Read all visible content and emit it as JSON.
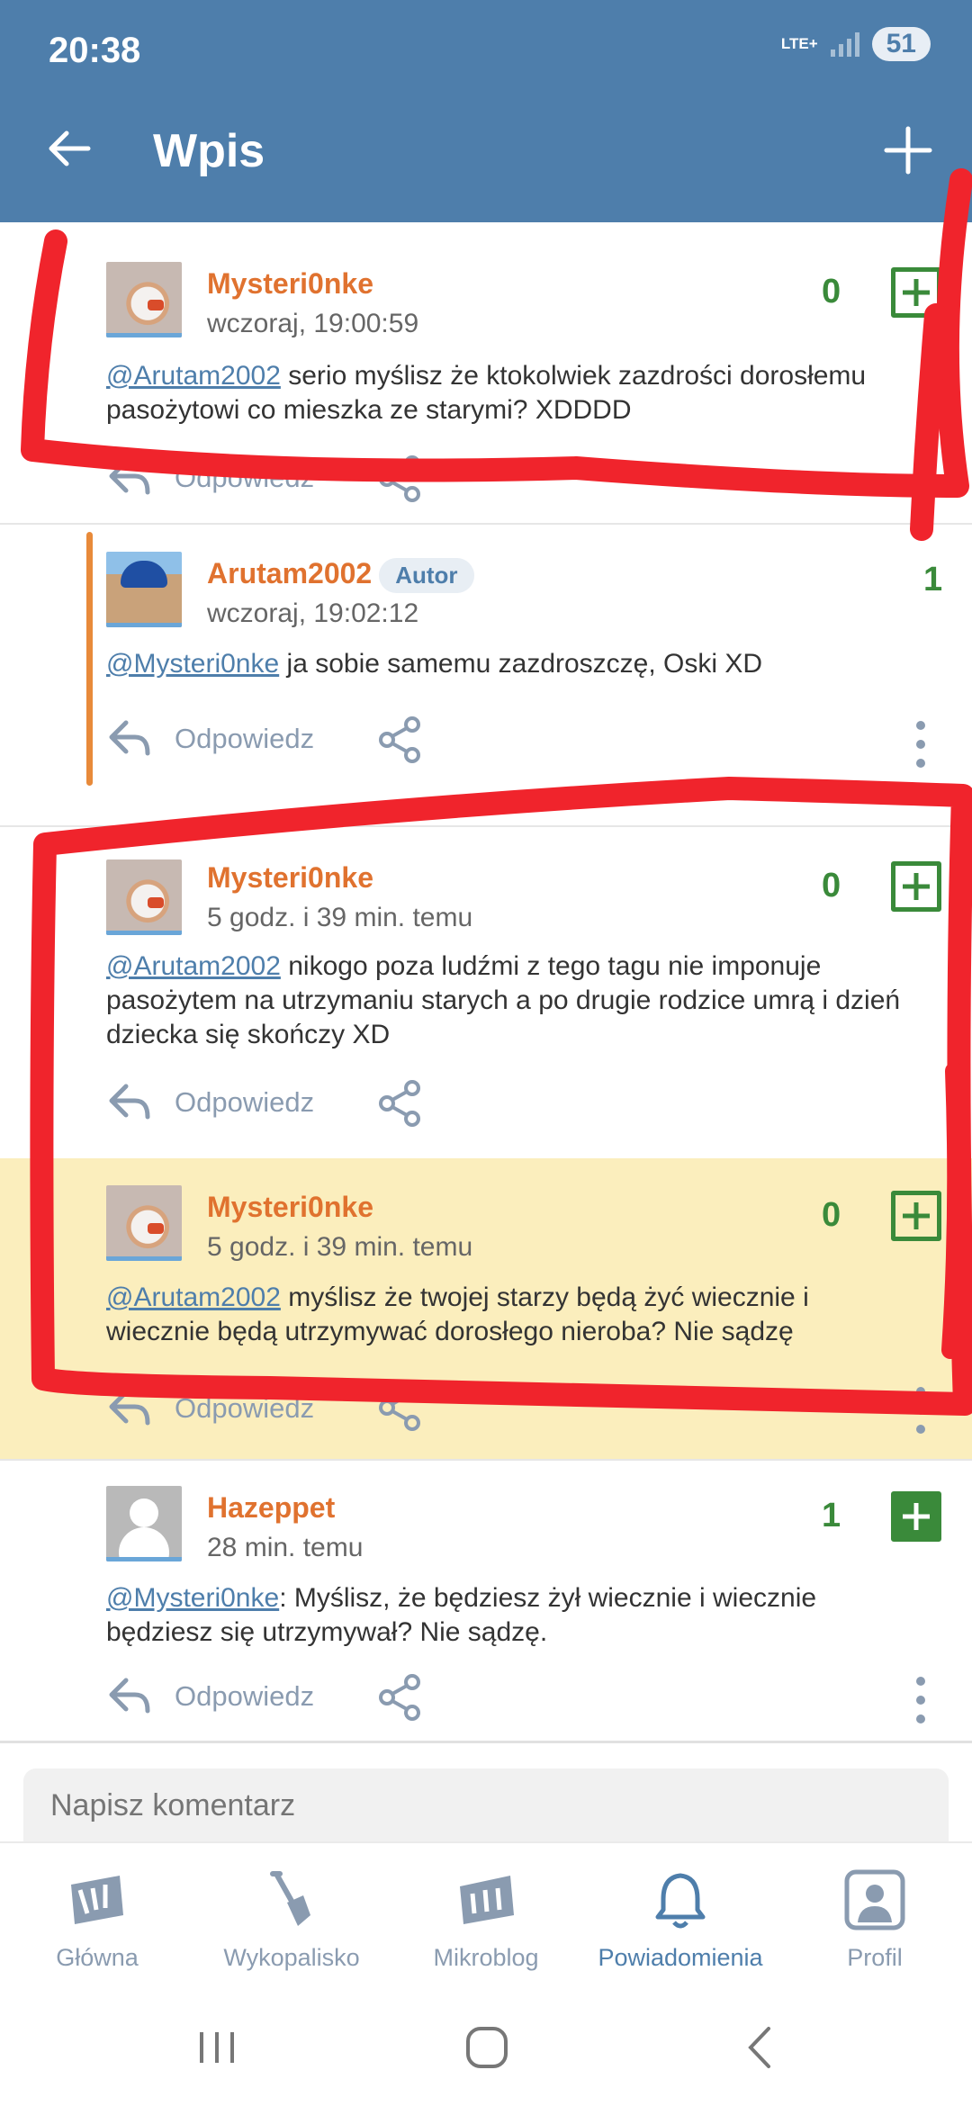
{
  "status_bar": {
    "time": "20:38",
    "network": "LTE+",
    "battery": "51"
  },
  "header": {
    "title": "Wpis",
    "back_icon": "arrow-left-icon",
    "add_icon": "plus-icon"
  },
  "comments": [
    {
      "author": "Mysteri0nke",
      "badge": "",
      "time": "wczoraj, 19:00:59",
      "mention": "@Arutam2002",
      "body": " serio myślisz że ktokolwiek zazdrości dorosłemu pasożytowi co mieszka ze starymi? XDDDD",
      "votes": "0",
      "reply_label": "Odpowiedz"
    },
    {
      "author": "Arutam2002",
      "badge": "Autor",
      "time": "wczoraj, 19:02:12",
      "mention": "@Mysteri0nke",
      "body": " ja sobie samemu zazdroszczę, Oski XD",
      "votes": "1",
      "reply_label": "Odpowiedz"
    },
    {
      "author": "Mysteri0nke",
      "badge": "",
      "time": "5 godz. i 39 min. temu",
      "mention": "@Arutam2002",
      "body": "  nikogo poza ludźmi z tego tagu nie imponuje pasożytem na utrzymaniu starych a po drugie rodzice umrą i dzień dziecka się skończy XD",
      "votes": "0",
      "reply_label": "Odpowiedz"
    },
    {
      "author": "Mysteri0nke",
      "badge": "",
      "time": "5 godz. i 39 min. temu",
      "mention": "@Arutam2002",
      "body": " myślisz że twojej starzy będą żyć wiecznie i wiecznie będą utrzymywać dorosłego nieroba? Nie sądzę",
      "votes": "0",
      "reply_label": "Odpowiedz"
    },
    {
      "author": "Hazeppet",
      "badge": "",
      "time": "28 min. temu",
      "mention": "@Mysteri0nke",
      "body": ": Myślisz, że będziesz żył wiecznie i wiecznie będziesz się utrzymywał? Nie sądzę.",
      "votes": "1",
      "reply_label": "Odpowiedz"
    }
  ],
  "composer": {
    "placeholder": "Napisz komentarz"
  },
  "bottom_nav": {
    "items": [
      {
        "label": "Główna",
        "icon": "home-w-icon"
      },
      {
        "label": "Wykopalisko",
        "icon": "shovel-icon"
      },
      {
        "label": "Mikroblog",
        "icon": "microblog-m-icon"
      },
      {
        "label": "Powiadomienia",
        "icon": "bell-icon"
      },
      {
        "label": "Profil",
        "icon": "profile-icon"
      }
    ],
    "active_index": 3
  },
  "colors": {
    "header": "#4e7eab",
    "author": "#e0722f",
    "vote_green": "#3a8a3a",
    "highlight": "#fbeebd",
    "annotation_red": "#f0242c"
  }
}
